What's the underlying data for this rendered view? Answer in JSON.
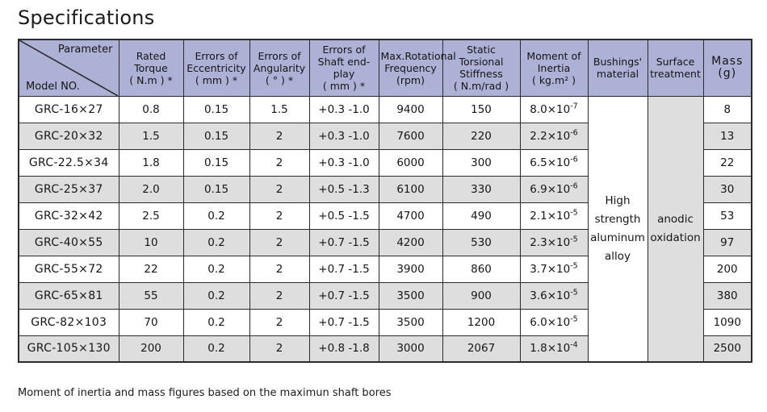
{
  "page": {
    "title": "Specifications",
    "footnote": "Moment of inertia and mass figures based on the maximun shaft bores"
  },
  "colors": {
    "header_background": "#aeb1d6",
    "row_alt_background": "#dedede",
    "row_background": "#ffffff",
    "border": "#2b2b2b",
    "text": "#161616"
  },
  "table": {
    "corner": {
      "parameter_label": "Parameter",
      "model_label": "Model NO."
    },
    "columns": [
      {
        "line1": "Rated Torque",
        "line2": "( N.m ) *",
        "line3": ""
      },
      {
        "line1": "Errors of",
        "line2": "Eccentricity",
        "line3": "( mm ) *"
      },
      {
        "line1": "Errors of",
        "line2": "Angularity",
        "line3": "( ° ) *"
      },
      {
        "line1": "Errors of",
        "line2": "Shaft end-play",
        "line3": "( mm ) *"
      },
      {
        "line1": "Max.Rotational",
        "line2": "Frequency",
        "line3": "(rpm)"
      },
      {
        "line1": "Static Torsional",
        "line2": "Stiffness",
        "line3": "( N.m/rad )"
      },
      {
        "line1": "Moment of",
        "line2": "Inertia",
        "line3": "( kg.m² )"
      },
      {
        "line1": "Bushings'",
        "line2": "material",
        "line3": ""
      },
      {
        "line1": "Surface",
        "line2": "treatment",
        "line3": ""
      },
      {
        "line1": "Mass",
        "line2": "(g)",
        "line3": ""
      }
    ],
    "merged": {
      "bushings_material": "High strength aluminum alloy",
      "surface_treatment": "anodic oxidation"
    },
    "rows": [
      {
        "model": "GRC-16×27",
        "rated_torque": "0.8",
        "errors_eccentricity": "0.15",
        "errors_angularity": "1.5",
        "shaft_end_play": "+0.3  -1.0",
        "max_rotational_frequency": "9400",
        "static_torsional_stiffness": "150",
        "moment_of_inertia_mantissa": "8.0×10",
        "moment_of_inertia_exponent": "-7",
        "mass": "8"
      },
      {
        "model": "GRC-20×32",
        "rated_torque": "1.5",
        "errors_eccentricity": "0.15",
        "errors_angularity": "2",
        "shaft_end_play": "+0.3  -1.0",
        "max_rotational_frequency": "7600",
        "static_torsional_stiffness": "220",
        "moment_of_inertia_mantissa": "2.2×10",
        "moment_of_inertia_exponent": "-6",
        "mass": "13"
      },
      {
        "model": "GRC-22.5×34",
        "rated_torque": "1.8",
        "errors_eccentricity": "0.15",
        "errors_angularity": "2",
        "shaft_end_play": "+0.3  -1.0",
        "max_rotational_frequency": "6000",
        "static_torsional_stiffness": "300",
        "moment_of_inertia_mantissa": "6.5×10",
        "moment_of_inertia_exponent": "-6",
        "mass": "22"
      },
      {
        "model": "GRC-25×37",
        "rated_torque": "2.0",
        "errors_eccentricity": "0.15",
        "errors_angularity": "2",
        "shaft_end_play": "+0.5  -1.3",
        "max_rotational_frequency": "6100",
        "static_torsional_stiffness": "330",
        "moment_of_inertia_mantissa": "6.9×10",
        "moment_of_inertia_exponent": "-6",
        "mass": "30"
      },
      {
        "model": "GRC-32×42",
        "rated_torque": "2.5",
        "errors_eccentricity": "0.2",
        "errors_angularity": "2",
        "shaft_end_play": "+0.5  -1.5",
        "max_rotational_frequency": "4700",
        "static_torsional_stiffness": "490",
        "moment_of_inertia_mantissa": "2.1×10",
        "moment_of_inertia_exponent": "-5",
        "mass": "53"
      },
      {
        "model": "GRC-40×55",
        "rated_torque": "10",
        "errors_eccentricity": "0.2",
        "errors_angularity": "2",
        "shaft_end_play": "+0.7  -1.5",
        "max_rotational_frequency": "4200",
        "static_torsional_stiffness": "530",
        "moment_of_inertia_mantissa": "2.3×10",
        "moment_of_inertia_exponent": "-5",
        "mass": "97"
      },
      {
        "model": "GRC-55×72",
        "rated_torque": "22",
        "errors_eccentricity": "0.2",
        "errors_angularity": "2",
        "shaft_end_play": "+0.7  -1.5",
        "max_rotational_frequency": "3900",
        "static_torsional_stiffness": "860",
        "moment_of_inertia_mantissa": "3.7×10",
        "moment_of_inertia_exponent": "-5",
        "mass": "200"
      },
      {
        "model": "GRC-65×81",
        "rated_torque": "55",
        "errors_eccentricity": "0.2",
        "errors_angularity": "2",
        "shaft_end_play": "+0.7  -1.5",
        "max_rotational_frequency": "3500",
        "static_torsional_stiffness": "900",
        "moment_of_inertia_mantissa": "3.6×10",
        "moment_of_inertia_exponent": "-5",
        "mass": "380"
      },
      {
        "model": "GRC-82×103",
        "rated_torque": "70",
        "errors_eccentricity": "0.2",
        "errors_angularity": "2",
        "shaft_end_play": "+0.7  -1.5",
        "max_rotational_frequency": "3500",
        "static_torsional_stiffness": "1200",
        "moment_of_inertia_mantissa": "6.0×10",
        "moment_of_inertia_exponent": "-5",
        "mass": "1090"
      },
      {
        "model": "GRC-105×130",
        "rated_torque": "200",
        "errors_eccentricity": "0.2",
        "errors_angularity": "2",
        "shaft_end_play": "+0.8  -1.8",
        "max_rotational_frequency": "3000",
        "static_torsional_stiffness": "2067",
        "moment_of_inertia_mantissa": "1.8×10",
        "moment_of_inertia_exponent": "-4",
        "mass": "2500"
      }
    ]
  }
}
